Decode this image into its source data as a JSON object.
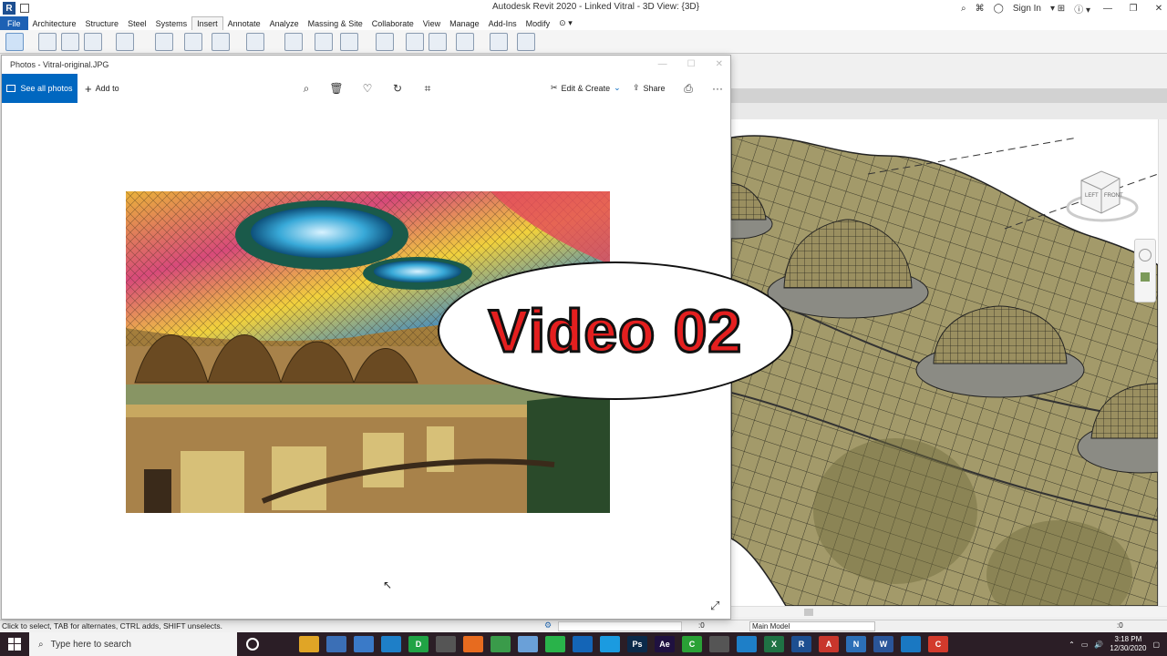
{
  "revit": {
    "window_title": "Autodesk Revit 2020 - Linked Vitral - 3D View: {3D}",
    "sign_in": "Sign In",
    "tabs": [
      "File",
      "Architecture",
      "Structure",
      "Steel",
      "Systems",
      "Insert",
      "Annotate",
      "Analyze",
      "Massing & Site",
      "Collaborate",
      "View",
      "Manage",
      "Add-Ins",
      "Modify"
    ],
    "active_tab": "Insert",
    "status_text": "Click to select, TAB for alternates, CTRL adds, SHIFT unselects.",
    "status_model": "Main Model",
    "status_zero": ":0",
    "status_zero2": ":0",
    "viewcube_faces": [
      "LEFT",
      "FRONT"
    ]
  },
  "photos": {
    "window_title": "Photos - Vitral-original.JPG",
    "see_all": "See all photos",
    "add_to": "Add to",
    "edit_create": "Edit & Create",
    "share": "Share"
  },
  "overlay": {
    "text": "Video 02"
  },
  "taskbar": {
    "search_placeholder": "Type here to search",
    "time": "3:18 PM",
    "date": "12/30/2020",
    "apps": [
      {
        "icon": "task-view-icon",
        "label": "",
        "color": "#2b1e26"
      },
      {
        "icon": "file-explorer-icon",
        "label": "",
        "color": "#e0a526"
      },
      {
        "icon": "store-icon",
        "label": "",
        "color": "#3b6fb6"
      },
      {
        "icon": "notepad-icon",
        "label": "",
        "color": "#3a7ac8"
      },
      {
        "icon": "edge-icon",
        "label": "",
        "color": "#1e7fc8"
      },
      {
        "icon": "d-app-icon",
        "label": "D",
        "color": "#20a345"
      },
      {
        "icon": "app-icon",
        "label": "",
        "color": "#555"
      },
      {
        "icon": "firefox-icon",
        "label": "",
        "color": "#e76b1f"
      },
      {
        "icon": "chrome-icon",
        "label": "",
        "color": "#3a9b4a"
      },
      {
        "icon": "app2-icon",
        "label": "",
        "color": "#6aa0d8"
      },
      {
        "icon": "whatsapp-icon",
        "label": "",
        "color": "#29b34a"
      },
      {
        "icon": "outlook-icon",
        "label": "",
        "color": "#1465b7"
      },
      {
        "icon": "skype-icon",
        "label": "",
        "color": "#1b9be0"
      },
      {
        "icon": "photoshop-icon",
        "label": "Ps",
        "color": "#0b2a4a"
      },
      {
        "icon": "aftereffects-icon",
        "label": "Ae",
        "color": "#1f1140"
      },
      {
        "icon": "c-app-icon",
        "label": "C",
        "color": "#2aa136"
      },
      {
        "icon": "calculator-icon",
        "label": "",
        "color": "#555"
      },
      {
        "icon": "edge2-icon",
        "label": "",
        "color": "#1e7fc8"
      },
      {
        "icon": "excel-icon",
        "label": "X",
        "color": "#1f7244"
      },
      {
        "icon": "revit-icon",
        "label": "R",
        "color": "#1d4f91"
      },
      {
        "icon": "autocad-icon",
        "label": "A",
        "color": "#c8362c"
      },
      {
        "icon": "navisworks-icon",
        "label": "N",
        "color": "#2c6fb7"
      },
      {
        "icon": "word-icon",
        "label": "W",
        "color": "#2a5599"
      },
      {
        "icon": "photos-icon",
        "label": "",
        "color": "#1a78c2"
      },
      {
        "icon": "c-app2-icon",
        "label": "C",
        "color": "#d33a2c"
      }
    ]
  }
}
